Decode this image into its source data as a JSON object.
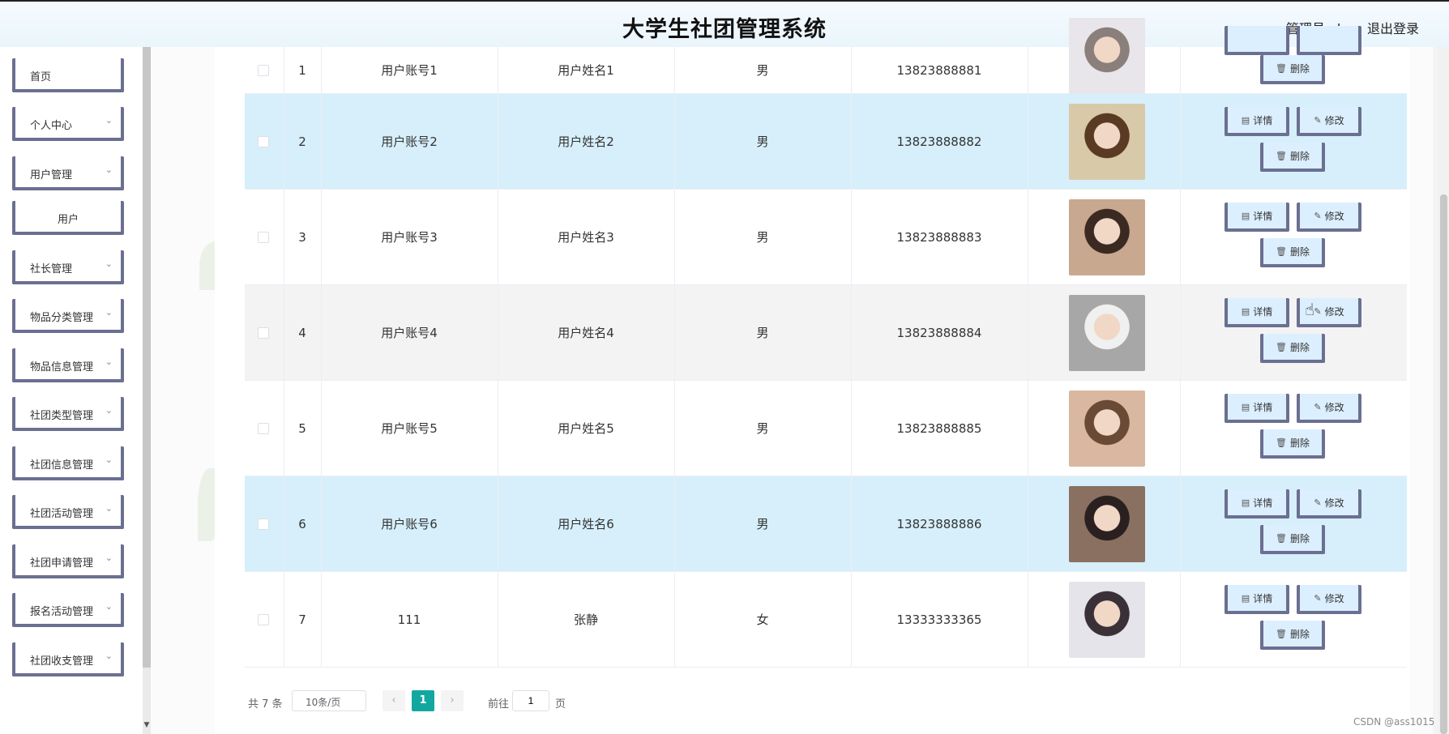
{
  "header": {
    "title": "大学生社团管理系统",
    "user": "管理员 abo",
    "logout": "退出登录"
  },
  "sidebar": {
    "items": [
      {
        "label": "首页",
        "chevron": ""
      },
      {
        "label": "个人中心",
        "chevron": "⌄"
      },
      {
        "label": "用户管理",
        "chevron": "⌄"
      },
      {
        "label": "用户",
        "chevron": ""
      },
      {
        "label": "社长管理",
        "chevron": "⌄"
      },
      {
        "label": "物品分类管理",
        "chevron": "⌄"
      },
      {
        "label": "物品信息管理",
        "chevron": "⌄"
      },
      {
        "label": "社团类型管理",
        "chevron": "⌄"
      },
      {
        "label": "社团信息管理",
        "chevron": "⌄"
      },
      {
        "label": "社团活动管理",
        "chevron": "⌄"
      },
      {
        "label": "社团申请管理",
        "chevron": "⌄"
      },
      {
        "label": "报名活动管理",
        "chevron": "⌄"
      },
      {
        "label": "社团收支管理",
        "chevron": "⌄"
      }
    ]
  },
  "table": {
    "rows": [
      {
        "index": "1",
        "account": "用户账号1",
        "name": "用户姓名1",
        "gender": "男",
        "phone": "13823888881",
        "avatar_color": "#e8e6ea",
        "hair": "#8a7f7a"
      },
      {
        "index": "2",
        "account": "用户账号2",
        "name": "用户姓名2",
        "gender": "男",
        "phone": "13823888882",
        "avatar_color": "#d8c9a8",
        "hair": "#5a3a22"
      },
      {
        "index": "3",
        "account": "用户账号3",
        "name": "用户姓名3",
        "gender": "男",
        "phone": "13823888883",
        "avatar_color": "#c9a890",
        "hair": "#3a2a22"
      },
      {
        "index": "4",
        "account": "用户账号4",
        "name": "用户姓名4",
        "gender": "男",
        "phone": "13823888884",
        "avatar_color": "#a7a7a7",
        "hair": "#f0f0f0"
      },
      {
        "index": "5",
        "account": "用户账号5",
        "name": "用户姓名5",
        "gender": "男",
        "phone": "13823888885",
        "avatar_color": "#d9b7a0",
        "hair": "#6b4a35"
      },
      {
        "index": "6",
        "account": "用户账号6",
        "name": "用户姓名6",
        "gender": "男",
        "phone": "13823888886",
        "avatar_color": "#8a7060",
        "hair": "#2a2020"
      },
      {
        "index": "7",
        "account": "111",
        "name": "张静",
        "gender": "女",
        "phone": "13333333365",
        "avatar_color": "#e4e4ea",
        "hair": "#3a3038"
      }
    ],
    "actions": {
      "detail": "详情",
      "edit": "修改",
      "delete": "删除"
    },
    "icons": {
      "detail": "document-icon",
      "edit": "pencil-icon",
      "delete": "trash-icon"
    }
  },
  "pagination": {
    "total": "共 7 条",
    "page_size": "10条/页",
    "current_page": "1",
    "goto_label": "前往",
    "goto_value": "1",
    "page_suffix": "页"
  },
  "watermark": "CSDN @ass1015",
  "colors": {
    "accent": "#12a8a0",
    "menu_border": "#6b6f91",
    "row_highlight": "#d6effb",
    "button_bg": "#dcefff"
  }
}
